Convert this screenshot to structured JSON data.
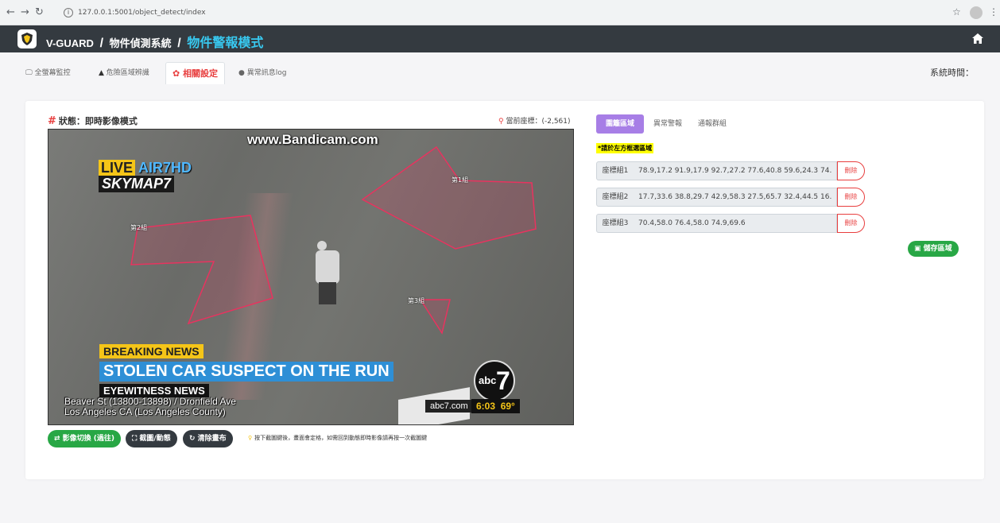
{
  "browser": {
    "url": "127.0.0.1:5001/object_detect/index",
    "back_icon": "arrow-left-icon",
    "forward_icon": "arrow-right-icon",
    "reload_icon": "reload-icon"
  },
  "navbar": {
    "brand": "V-GUARD",
    "system": "物件偵測系統",
    "mode": "物件警報模式",
    "separator": "/"
  },
  "tabs": [
    {
      "label": "全螢幕監控",
      "icon": "monitor-icon"
    },
    {
      "label": "危險區域辨識",
      "icon": "warning-icon"
    },
    {
      "label": "相關設定",
      "icon": "gear-icon"
    },
    {
      "label": "異常訊息log",
      "icon": "chat-icon"
    }
  ],
  "system_time_label": "系統時間：",
  "status": {
    "hash": "#",
    "label": "狀態：即時影像模式"
  },
  "coordinate": {
    "label": "當前座標：",
    "value": "(-2,561)"
  },
  "video": {
    "watermark": "www.Bandicam.com",
    "live": "LIVE",
    "channel": "AIR7HD",
    "skymap": "SKYMAP7",
    "breaking": "BREAKING NEWS",
    "headline": "STOLEN CAR SUSPECT ON THE RUN",
    "eyewitness": "EYEWITNESS NEWS",
    "location_line1": "Beaver St (13800-13898) / Dronfield Ave",
    "location_line2": "Los Angeles CA (Los Angeles County)",
    "abc": "abc",
    "seven": "7",
    "site": "abc7.com",
    "time": "6:03",
    "temp": "69°",
    "regions": [
      {
        "label": "第1組"
      },
      {
        "label": "第2組"
      },
      {
        "label": "第3組"
      }
    ]
  },
  "video_buttons": {
    "switch": "⇄ 影像切換 (過往)",
    "capture": "⛶ 截圖/動態",
    "clear": "↻ 清除畫布"
  },
  "hint": "按下截圖鍵後，畫面會定格，如需回到動態即時影像請再按一次截圖鍵",
  "right_tabs": [
    "圍籬區域",
    "異常警報",
    "通報群組"
  ],
  "note": "*請於左方框選區域",
  "groups": [
    {
      "label": "座標組1",
      "value": "78.9,17.2 91.9,17.9 92.7,27.2 77.6,40.8 59.6,24.3 74.",
      "delete": "刪除"
    },
    {
      "label": "座標組2",
      "value": "17.7,33.6 38.8,29.7 42.9,58.3 27.5,65.7 32.4,44.5 16.",
      "delete": "刪除"
    },
    {
      "label": "座標組3",
      "value": "70.4,58.0 76.4,58.0 74.9,69.6",
      "delete": "刪除"
    }
  ],
  "save_button": "儲存區域",
  "colors": {
    "navbar_bg": "#343a40",
    "mode_text": "#38c9f0",
    "active_tab": "#e83e3e",
    "right_tab_active": "#a77ee6",
    "success": "#28a745",
    "region_stroke": "#e8335f"
  }
}
